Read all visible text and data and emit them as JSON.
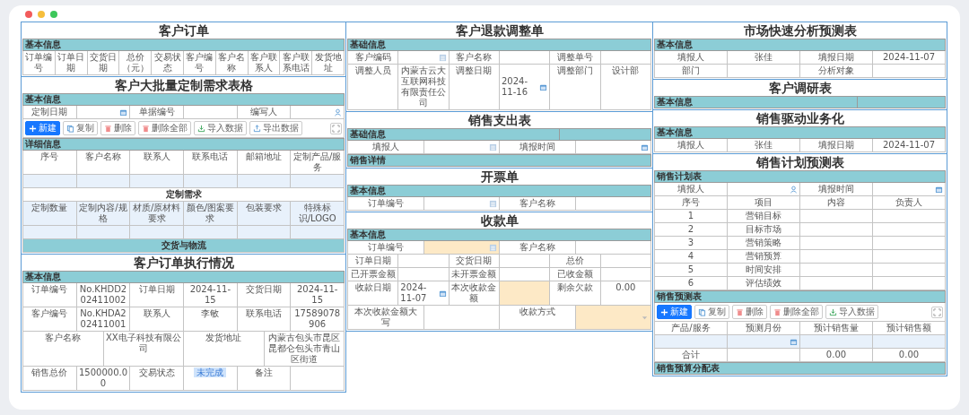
{
  "window": {
    "controls": [
      {
        "kind": "close"
      },
      {
        "kind": "minimize"
      },
      {
        "kind": "zoom"
      }
    ]
  },
  "columns": [
    {
      "cards": [
        {
          "title": "客户订单",
          "blocks": [
            {
              "kind": "section",
              "label": "基本信息"
            },
            {
              "kind": "row",
              "cells": [
                {
                  "kind": "label",
                  "text": "订单编号"
                },
                {
                  "kind": "label",
                  "text": "订单日期"
                },
                {
                  "kind": "label",
                  "text": "交货日期"
                },
                {
                  "kind": "label",
                  "text": "总价（元）"
                },
                {
                  "kind": "label",
                  "text": "交易状态"
                },
                {
                  "kind": "label",
                  "text": "客户编号"
                },
                {
                  "kind": "label",
                  "text": "客户名称"
                },
                {
                  "kind": "label",
                  "text": "客户联系人"
                },
                {
                  "kind": "label",
                  "text": "客户联系电话"
                },
                {
                  "kind": "label",
                  "text": "发货地址"
                }
              ]
            }
          ]
        },
        {
          "title": "客户大批量定制需求表格",
          "blocks": [
            {
              "kind": "section",
              "label": "基本信息"
            },
            {
              "kind": "row",
              "cells": [
                {
                  "kind": "label",
                  "text": "定制日期"
                },
                {
                  "kind": "date-field"
                },
                {
                  "kind": "label",
                  "text": "单据编号"
                },
                {
                  "kind": "field"
                },
                {
                  "kind": "label",
                  "text": "编写人"
                },
                {
                  "kind": "user-field"
                }
              ]
            },
            {
              "kind": "toolbar",
              "expand": true,
              "buttons": [
                {
                  "kind": "new",
                  "label": "新建",
                  "primary": true
                },
                {
                  "kind": "copy",
                  "label": "复制",
                  "primary": false
                },
                {
                  "kind": "delete",
                  "label": "删除",
                  "primary": false
                },
                {
                  "kind": "delete-all",
                  "label": "删除全部",
                  "primary": false
                },
                {
                  "kind": "import",
                  "label": "导入数据",
                  "primary": false
                },
                {
                  "kind": "export",
                  "label": "导出数据",
                  "primary": false
                }
              ]
            },
            {
              "kind": "section",
              "label": "详细信息"
            },
            {
              "kind": "row",
              "cells": [
                {
                  "kind": "label",
                  "text": "序号"
                },
                {
                  "kind": "label",
                  "text": "客户名称"
                },
                {
                  "kind": "label",
                  "text": "联系人"
                },
                {
                  "kind": "label",
                  "text": "联系电话"
                },
                {
                  "kind": "label",
                  "text": "邮箱地址"
                },
                {
                  "kind": "label",
                  "text": "定制产品/服务"
                }
              ]
            },
            {
              "kind": "row",
              "tinted": true,
              "cells": [
                {
                  "kind": "blank"
                },
                {
                  "kind": "blank"
                },
                {
                  "kind": "blank"
                },
                {
                  "kind": "blank"
                },
                {
                  "kind": "blank"
                },
                {
                  "kind": "blank"
                }
              ]
            },
            {
              "kind": "group",
              "label": "定制需求",
              "tinted": false
            },
            {
              "kind": "row",
              "tinted": true,
              "cells": [
                {
                  "kind": "label",
                  "text": "定制数量"
                },
                {
                  "kind": "label",
                  "text": "定制内容/规格"
                },
                {
                  "kind": "label",
                  "text": "材质/原材料要求"
                },
                {
                  "kind": "label",
                  "text": "颜色/图案要求"
                },
                {
                  "kind": "label",
                  "text": "包装要求"
                },
                {
                  "kind": "label",
                  "text": "特殊标识/LOGO"
                }
              ]
            },
            {
              "kind": "row",
              "tinted": true,
              "cells": [
                {
                  "kind": "blank"
                },
                {
                  "kind": "blank"
                },
                {
                  "kind": "blank"
                },
                {
                  "kind": "blank"
                },
                {
                  "kind": "blank"
                },
                {
                  "kind": "blank"
                }
              ]
            },
            {
              "kind": "group",
              "label": "交货与物流",
              "tinted": true
            }
          ]
        },
        {
          "title": "客户订单执行情况",
          "blocks": [
            {
              "kind": "section",
              "label": "基本信息"
            },
            {
              "kind": "row",
              "cells": [
                {
                  "kind": "label",
                  "text": "订单编号"
                },
                {
                  "kind": "text",
                  "text": "No.KHDD202411002"
                },
                {
                  "kind": "label",
                  "text": "订单日期"
                },
                {
                  "kind": "text",
                  "text": "2024-11-15"
                },
                {
                  "kind": "label",
                  "text": "交货日期"
                },
                {
                  "kind": "text",
                  "text": "2024-11-15"
                }
              ]
            },
            {
              "kind": "row",
              "cells": [
                {
                  "kind": "label",
                  "text": "客户编号"
                },
                {
                  "kind": "text",
                  "text": "No.KHDA202411001"
                },
                {
                  "kind": "label",
                  "text": "联系人"
                },
                {
                  "kind": "text",
                  "text": "李敏"
                },
                {
                  "kind": "label",
                  "text": "联系电话"
                },
                {
                  "kind": "text",
                  "text": "17589078906"
                }
              ]
            },
            {
              "kind": "row",
              "cells": [
                {
                  "kind": "label",
                  "text": "客户名称"
                },
                {
                  "kind": "text",
                  "text": "XX电子科技有限公司"
                },
                {
                  "kind": "label",
                  "text": "发货地址"
                },
                {
                  "kind": "text",
                  "text": "内蒙古包头市昆区昆都仑包头市青山区街道"
                }
              ]
            },
            {
              "kind": "row",
              "cells": [
                {
                  "kind": "label",
                  "text": "销售总价"
                },
                {
                  "kind": "text",
                  "text": "1500000.00"
                },
                {
                  "kind": "label",
                  "text": "交易状态"
                },
                {
                  "kind": "status",
                  "text": "未完成"
                },
                {
                  "kind": "label",
                  "text": "备注"
                },
                {
                  "kind": "blank"
                }
              ]
            }
          ]
        }
      ]
    },
    {
      "cards": [
        {
          "title": "客户退款调整单",
          "blocks": [
            {
              "kind": "section",
              "label": "基础信息"
            },
            {
              "kind": "row",
              "cells": [
                {
                  "kind": "label",
                  "text": "客户编码"
                },
                {
                  "kind": "picker-field"
                },
                {
                  "kind": "label",
                  "text": "客户名称"
                },
                {
                  "kind": "field"
                },
                {
                  "kind": "label",
                  "text": "调整单号"
                },
                {
                  "kind": "field"
                }
              ]
            },
            {
              "kind": "row",
              "cells": [
                {
                  "kind": "label",
                  "text": "调整人员"
                },
                {
                  "kind": "text",
                  "text": "内蒙古云大互联网科技有限责任公司"
                },
                {
                  "kind": "label",
                  "text": "调整日期"
                },
                {
                  "kind": "date-field",
                  "value": "2024-11-16"
                },
                {
                  "kind": "label",
                  "text": "调整部门"
                },
                {
                  "kind": "text",
                  "text": "设计部"
                }
              ]
            }
          ]
        },
        {
          "title": "销售支出表",
          "blocks": [
            {
              "kind": "section",
              "label": "基础信息",
              "split": true
            },
            {
              "kind": "row",
              "cells": [
                {
                  "kind": "label",
                  "text": "填报人"
                },
                {
                  "kind": "picker-field"
                },
                {
                  "kind": "label",
                  "text": "填报时间"
                },
                {
                  "kind": "date-field"
                }
              ]
            },
            {
              "kind": "section",
              "label": "销售详情"
            }
          ]
        },
        {
          "title": "开票单",
          "blocks": [
            {
              "kind": "section",
              "label": "基本信息"
            },
            {
              "kind": "row",
              "cells": [
                {
                  "kind": "label",
                  "text": "订单编号"
                },
                {
                  "kind": "picker-field"
                },
                {
                  "kind": "label",
                  "text": "客户名称"
                },
                {
                  "kind": "field"
                }
              ]
            }
          ]
        },
        {
          "title": "收款单",
          "blocks": [
            {
              "kind": "section",
              "label": "基本信息"
            },
            {
              "kind": "row",
              "cells": [
                {
                  "kind": "label",
                  "text": "订单编号"
                },
                {
                  "kind": "picker-field",
                  "highlight": true
                },
                {
                  "kind": "label",
                  "text": "客户名称"
                },
                {
                  "kind": "field"
                }
              ]
            },
            {
              "kind": "row",
              "cells": [
                {
                  "kind": "label",
                  "text": "订单日期"
                },
                {
                  "kind": "field"
                },
                {
                  "kind": "label",
                  "text": "交货日期"
                },
                {
                  "kind": "field"
                },
                {
                  "kind": "label",
                  "text": "总价"
                },
                {
                  "kind": "field"
                }
              ]
            },
            {
              "kind": "row",
              "cells": [
                {
                  "kind": "label",
                  "text": "已开票金额"
                },
                {
                  "kind": "field"
                },
                {
                  "kind": "label",
                  "text": "未开票金额"
                },
                {
                  "kind": "field"
                },
                {
                  "kind": "label",
                  "text": "已收金额"
                },
                {
                  "kind": "field"
                }
              ]
            },
            {
              "kind": "row",
              "cells": [
                {
                  "kind": "label",
                  "text": "收款日期"
                },
                {
                  "kind": "date-field",
                  "value": "2024-11-07"
                },
                {
                  "kind": "label",
                  "text": "本次收款金额"
                },
                {
                  "kind": "field",
                  "highlight": true
                },
                {
                  "kind": "label",
                  "text": "剩余欠款"
                },
                {
                  "kind": "text",
                  "text": "0.00"
                }
              ]
            },
            {
              "kind": "row",
              "cells": [
                {
                  "kind": "label",
                  "text": "本次收款金额大写"
                },
                {
                  "kind": "field"
                },
                {
                  "kind": "label",
                  "text": "收款方式"
                },
                {
                  "kind": "select-field",
                  "highlight": true
                }
              ]
            }
          ]
        }
      ]
    },
    {
      "cards": [
        {
          "title": "市场快速分析预测表",
          "blocks": [
            {
              "kind": "section",
              "label": "基本信息"
            },
            {
              "kind": "row",
              "cells": [
                {
                  "kind": "label",
                  "text": "填报人"
                },
                {
                  "kind": "text",
                  "text": "张佳"
                },
                {
                  "kind": "label",
                  "text": "填报日期"
                },
                {
                  "kind": "text",
                  "text": "2024-11-07"
                }
              ]
            },
            {
              "kind": "row",
              "cells": [
                {
                  "kind": "label",
                  "text": "部门"
                },
                {
                  "kind": "field"
                },
                {
                  "kind": "label",
                  "text": "分析对象"
                },
                {
                  "kind": "field"
                }
              ]
            }
          ]
        },
        {
          "title": "客户调研表",
          "blocks": [
            {
              "kind": "section",
              "label": "基本信息",
              "split": true
            }
          ]
        },
        {
          "title": "销售驱动业务化",
          "blocks": [
            {
              "kind": "section",
              "label": "基本信息"
            },
            {
              "kind": "row",
              "cells": [
                {
                  "kind": "label",
                  "text": "填报人"
                },
                {
                  "kind": "text",
                  "text": "张佳"
                },
                {
                  "kind": "label",
                  "text": "填报日期"
                },
                {
                  "kind": "text",
                  "text": "2024-11-07"
                }
              ]
            }
          ]
        },
        {
          "title": "销售计划预测表",
          "blocks": [
            {
              "kind": "section",
              "label": "销售计划表"
            },
            {
              "kind": "row",
              "cells": [
                {
                  "kind": "label",
                  "text": "填报人"
                },
                {
                  "kind": "user-field"
                },
                {
                  "kind": "label",
                  "text": "填报时间"
                },
                {
                  "kind": "date-field"
                }
              ]
            },
            {
              "kind": "row",
              "cells": [
                {
                  "kind": "label",
                  "text": "序号"
                },
                {
                  "kind": "label",
                  "text": "项目"
                },
                {
                  "kind": "label",
                  "text": "内容"
                },
                {
                  "kind": "label",
                  "text": "负责人"
                }
              ]
            },
            {
              "kind": "row",
              "cells": [
                {
                  "kind": "text",
                  "text": "1"
                },
                {
                  "kind": "text",
                  "text": "营销目标"
                },
                {
                  "kind": "blank"
                },
                {
                  "kind": "blank"
                }
              ]
            },
            {
              "kind": "row",
              "cells": [
                {
                  "kind": "text",
                  "text": "2"
                },
                {
                  "kind": "text",
                  "text": "目标市场"
                },
                {
                  "kind": "blank"
                },
                {
                  "kind": "blank"
                }
              ]
            },
            {
              "kind": "row",
              "cells": [
                {
                  "kind": "text",
                  "text": "3"
                },
                {
                  "kind": "text",
                  "text": "营销策略"
                },
                {
                  "kind": "blank"
                },
                {
                  "kind": "blank"
                }
              ]
            },
            {
              "kind": "row",
              "cells": [
                {
                  "kind": "text",
                  "text": "4"
                },
                {
                  "kind": "text",
                  "text": "营销预算"
                },
                {
                  "kind": "blank"
                },
                {
                  "kind": "blank"
                }
              ]
            },
            {
              "kind": "row",
              "cells": [
                {
                  "kind": "text",
                  "text": "5"
                },
                {
                  "kind": "text",
                  "text": "时间安排"
                },
                {
                  "kind": "blank"
                },
                {
                  "kind": "blank"
                }
              ]
            },
            {
              "kind": "row",
              "cells": [
                {
                  "kind": "text",
                  "text": "6"
                },
                {
                  "kind": "text",
                  "text": "评估绩效"
                },
                {
                  "kind": "blank"
                },
                {
                  "kind": "blank"
                }
              ]
            },
            {
              "kind": "section",
              "label": "销售预测表"
            },
            {
              "kind": "toolbar",
              "expand": true,
              "buttons": [
                {
                  "kind": "new",
                  "label": "新建",
                  "primary": true
                },
                {
                  "kind": "copy",
                  "label": "复制",
                  "primary": false
                },
                {
                  "kind": "delete",
                  "label": "删除",
                  "primary": false
                },
                {
                  "kind": "delete-all",
                  "label": "删除全部",
                  "primary": false
                },
                {
                  "kind": "import",
                  "label": "导入数据",
                  "primary": false
                }
              ]
            },
            {
              "kind": "row",
              "cells": [
                {
                  "kind": "label",
                  "text": "产品/服务"
                },
                {
                  "kind": "label",
                  "text": "预测月份"
                },
                {
                  "kind": "label",
                  "text": "预计销售量"
                },
                {
                  "kind": "label",
                  "text": "预计销售额"
                }
              ]
            },
            {
              "kind": "row",
              "tinted": true,
              "cells": [
                {
                  "kind": "blank"
                },
                {
                  "kind": "date-field"
                },
                {
                  "kind": "blank"
                },
                {
                  "kind": "blank"
                }
              ]
            },
            {
              "kind": "row",
              "cells": [
                {
                  "kind": "text",
                  "text": "合计"
                },
                {
                  "kind": "blank"
                },
                {
                  "kind": "text",
                  "text": "0.00"
                },
                {
                  "kind": "text",
                  "text": "0.00"
                }
              ]
            },
            {
              "kind": "section",
              "label": "销售预算分配表"
            }
          ]
        }
      ]
    }
  ]
}
